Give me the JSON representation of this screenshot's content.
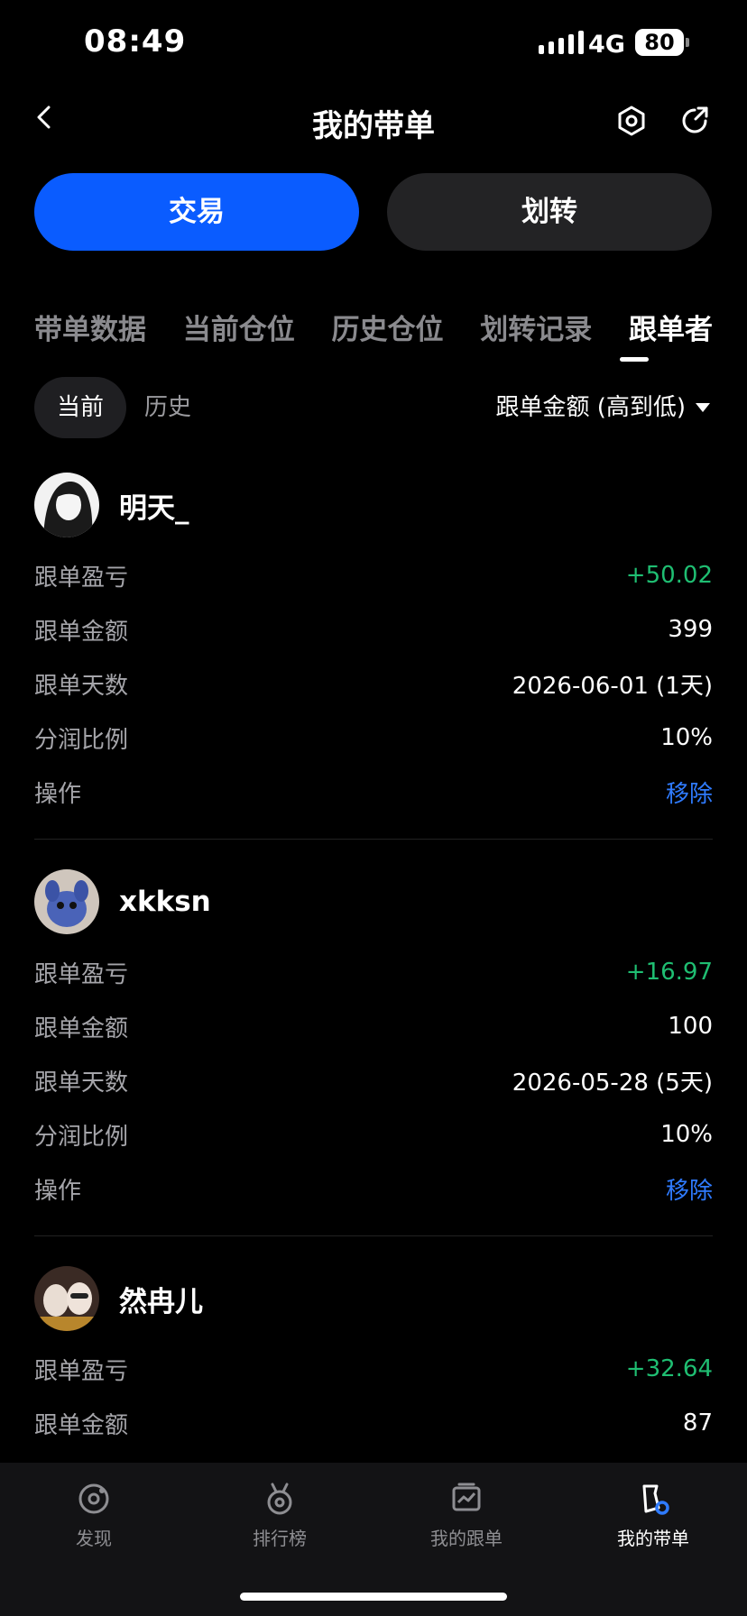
{
  "status": {
    "time": "08:49",
    "network": "4G",
    "battery": "80"
  },
  "header": {
    "title": "我的带单"
  },
  "actions": {
    "trade_label": "交易",
    "transfer_label": "划转"
  },
  "tabs": [
    {
      "label": "带单数据",
      "active": false
    },
    {
      "label": "当前仓位",
      "active": false
    },
    {
      "label": "历史仓位",
      "active": false
    },
    {
      "label": "划转记录",
      "active": false
    },
    {
      "label": "跟单者",
      "active": true
    }
  ],
  "filters": {
    "current": "当前",
    "history": "历史",
    "sort": "跟单金额 (高到低)"
  },
  "followers": [
    {
      "name": "明天_",
      "pnl_label": "跟单盈亏",
      "pnl": "+50.02",
      "amount_label": "跟单金额",
      "amount": "399",
      "days_label": "跟单天数",
      "days": "2026-06-01 (1天)",
      "share_label": "分润比例",
      "share": "10%",
      "op_label": "操作",
      "op": "移除"
    },
    {
      "name": "xkksn",
      "pnl_label": "跟单盈亏",
      "pnl": "+16.97",
      "amount_label": "跟单金额",
      "amount": "100",
      "days_label": "跟单天数",
      "days": "2026-05-28 (5天)",
      "share_label": "分润比例",
      "share": "10%",
      "op_label": "操作",
      "op": "移除"
    },
    {
      "name": "然冉儿",
      "pnl_label": "跟单盈亏",
      "pnl": "+32.64",
      "amount_label": "跟单金额",
      "amount": "87"
    }
  ],
  "nav": [
    {
      "label": "发现",
      "icon": "discover-icon"
    },
    {
      "label": "排行榜",
      "icon": "ranking-icon"
    },
    {
      "label": "我的跟单",
      "icon": "my-copy-icon"
    },
    {
      "label": "我的带单",
      "icon": "my-lead-icon",
      "active": true
    }
  ],
  "colors": {
    "accent": "#0a5cff",
    "profit": "#1fbe72",
    "link": "#2f7bff"
  }
}
